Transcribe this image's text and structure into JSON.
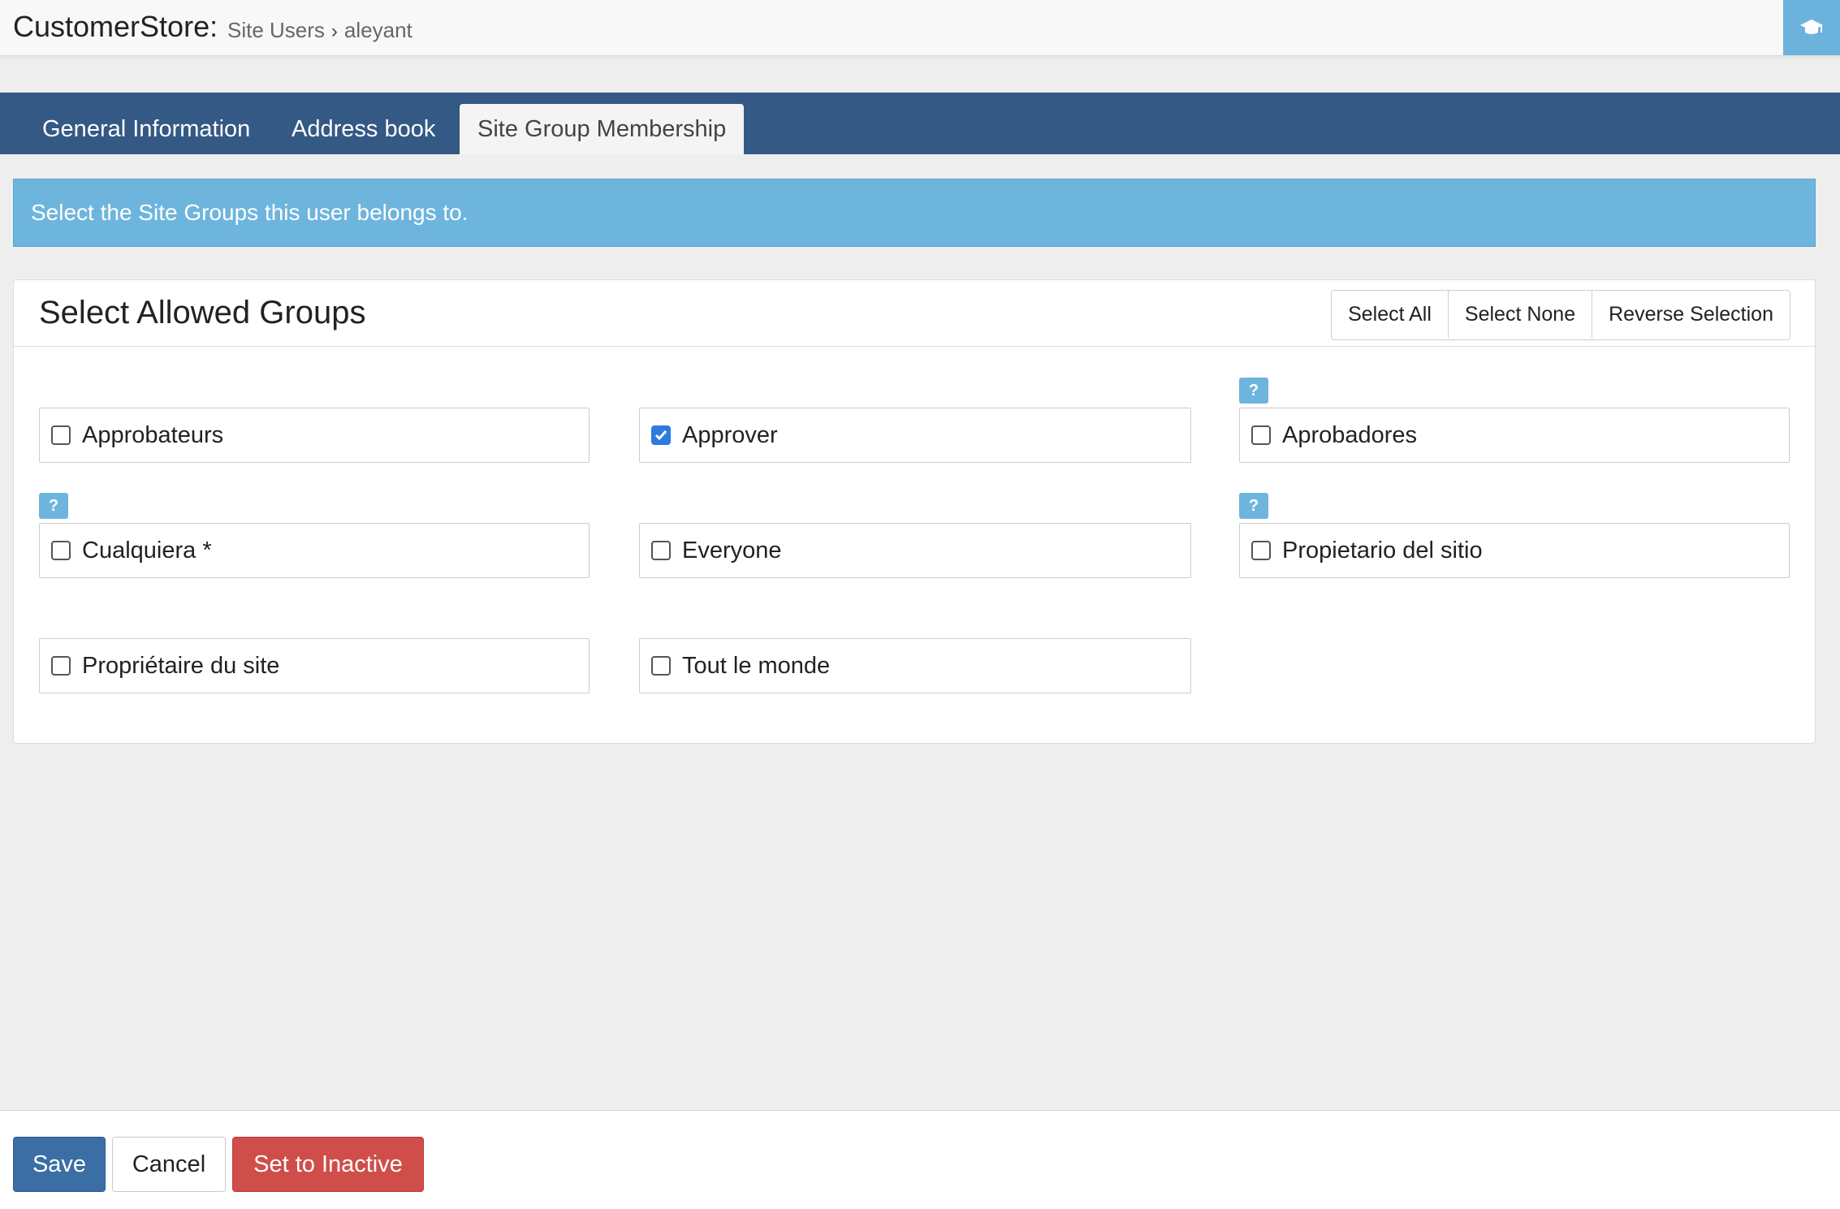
{
  "header": {
    "app_title": "CustomerStore:",
    "breadcrumb": [
      "Site Users",
      "aleyant"
    ],
    "help_icon": "graduation-cap-icon"
  },
  "tabs": [
    {
      "label": "General Information",
      "active": false
    },
    {
      "label": "Address book",
      "active": false
    },
    {
      "label": "Site Group Membership",
      "active": true
    }
  ],
  "banner": {
    "text": "Select the Site Groups this user belongs to."
  },
  "panel": {
    "title": "Select Allowed Groups",
    "actions": [
      "Select All",
      "Select None",
      "Reverse Selection"
    ],
    "help_badge": "?",
    "groups": [
      {
        "label": "Approbateurs",
        "checked": false,
        "has_help": false
      },
      {
        "label": "Approver",
        "checked": true,
        "has_help": false
      },
      {
        "label": "Aprobadores",
        "checked": false,
        "has_help": true
      },
      {
        "label": "Cualquiera *",
        "checked": false,
        "has_help": true
      },
      {
        "label": "Everyone",
        "checked": false,
        "has_help": false
      },
      {
        "label": "Propietario del sitio",
        "checked": false,
        "has_help": true
      },
      {
        "label": "Propriétaire du site",
        "checked": false,
        "has_help": false
      },
      {
        "label": "Tout le monde",
        "checked": false,
        "has_help": false
      }
    ]
  },
  "footer": {
    "save_label": "Save",
    "cancel_label": "Cancel",
    "inactive_label": "Set to Inactive"
  },
  "colors": {
    "tabbar": "#345984",
    "banner": "#6eb5de",
    "primary": "#3a6ea5",
    "danger": "#cf4e4a",
    "checkbox_checked": "#2d7be0"
  }
}
